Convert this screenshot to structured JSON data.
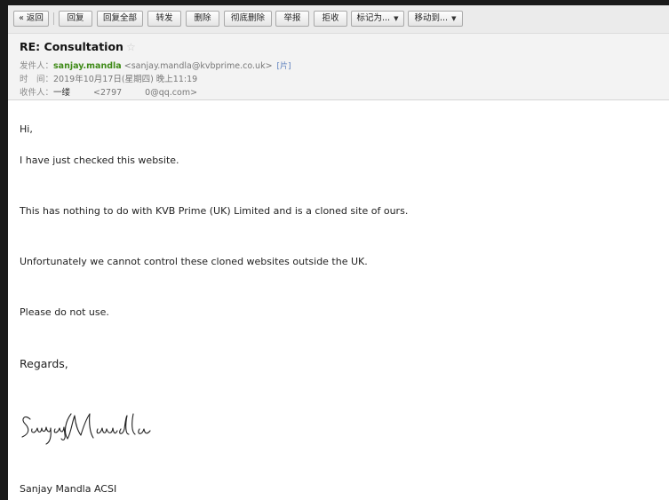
{
  "toolbar": {
    "back": "« 返回",
    "reply": "回复",
    "reply_all": "回复全部",
    "forward": "转发",
    "delete": "删除",
    "delete_permanently": "彻底删除",
    "report": "举报",
    "reject": "拒收",
    "mark_as": "标记为...",
    "move_to": "移动到..."
  },
  "email": {
    "subject": "RE: Consultation",
    "from_label": "发件人：",
    "from_name": "sanjay.mandla",
    "from_addr": "<sanjay.mandla@kvbprime.co.uk>",
    "card_label": "[片]",
    "time_label": "时　间：",
    "time_value": "2019年10月17日(星期四) 晚上11:19",
    "to_label": "收件人：",
    "to_name": "一缕",
    "to_addr_start": "<2797",
    "to_addr_end": "0@qq.com>"
  },
  "body": {
    "greeting": "Hi,",
    "p1": "I have just checked this website.",
    "p2": "This has nothing to do with KVB Prime (UK) Limited and is a cloned site of ours.",
    "p3": "Unfortunately we cannot control these cloned websites outside the UK.",
    "p4": "Please do not use.",
    "regards": "Regards,",
    "signature_text": "Sanjay Mandla",
    "sign_name": "Sanjay Mandla ACSI"
  },
  "colors": {
    "sender_name": "#3e8a17",
    "toolbar_bg": "#ebebeb",
    "header_bg": "#f3f3f3",
    "outer_bg": "#1a1a1a"
  }
}
